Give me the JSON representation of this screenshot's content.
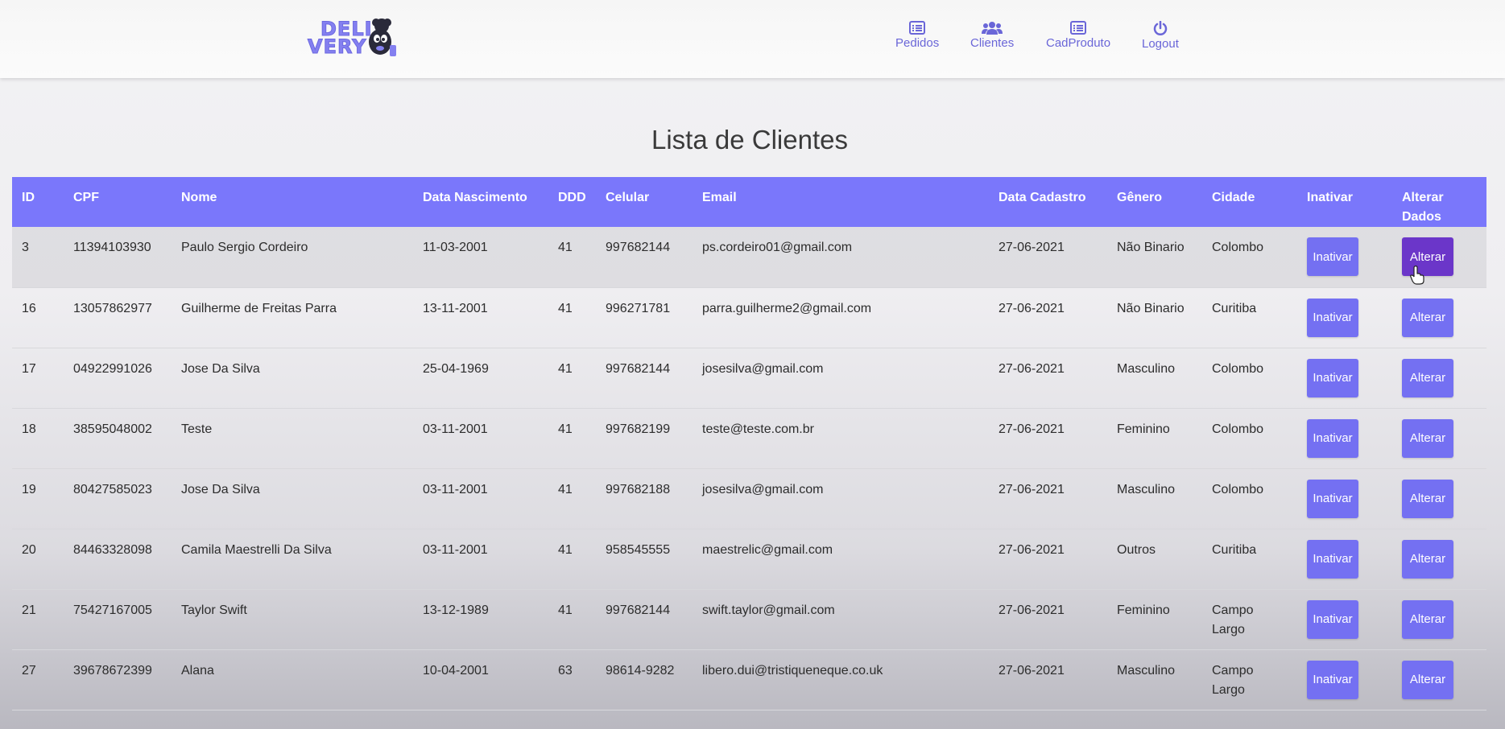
{
  "brand": {
    "logo_text_line1": "DELI",
    "logo_text_line2": "VERY"
  },
  "nav": {
    "items": [
      {
        "label": "Pedidos",
        "icon": "list-icon"
      },
      {
        "label": "Clientes",
        "icon": "users-icon"
      },
      {
        "label": "CadProduto",
        "icon": "list-icon"
      },
      {
        "label": "Logout",
        "icon": "power-icon"
      }
    ]
  },
  "page": {
    "title": "Lista de Clientes"
  },
  "table": {
    "headers": [
      "ID",
      "CPF",
      "Nome",
      "Data Nascimento",
      "DDD",
      "Celular",
      "Email",
      "Data Cadastro",
      "Gênero",
      "Cidade",
      "Inativar",
      "Alterar Dados"
    ],
    "inativar_label": "Inativar",
    "alterar_label": "Alterar",
    "rows": [
      [
        "3",
        "11394103930",
        "Paulo Sergio Cordeiro",
        "11-03-2001",
        "41",
        "997682144",
        "ps.cordeiro01@gmail.com",
        "27-06-2021",
        "Não Binario",
        "Colombo"
      ],
      [
        "16",
        "13057862977",
        "Guilherme de Freitas Parra",
        "13-11-2001",
        "41",
        "996271781",
        "parra.guilherme2@gmail.com",
        "27-06-2021",
        "Não Binario",
        "Curitiba"
      ],
      [
        "17",
        "04922991026",
        "Jose Da Silva",
        "25-04-1969",
        "41",
        "997682144",
        "josesilva@gmail.com",
        "27-06-2021",
        "Masculino",
        "Colombo"
      ],
      [
        "18",
        "38595048002",
        "Teste",
        "03-11-2001",
        "41",
        "997682199",
        "teste@teste.com.br",
        "27-06-2021",
        "Feminino",
        "Colombo"
      ],
      [
        "19",
        "80427585023",
        "Jose Da Silva",
        "03-11-2001",
        "41",
        "997682188",
        "josesilva@gmail.com",
        "27-06-2021",
        "Masculino",
        "Colombo"
      ],
      [
        "20",
        "84463328098",
        "Camila Maestrelli Da Silva",
        "03-11-2001",
        "41",
        "958545555",
        "maestrelic@gmail.com",
        "27-06-2021",
        "Outros",
        "Curitiba"
      ],
      [
        "21",
        "75427167005",
        "Taylor Swift",
        "13-12-1989",
        "41",
        "997682144",
        "swift.taylor@gmail.com",
        "27-06-2021",
        "Feminino",
        "Campo Largo"
      ],
      [
        "27",
        "39678672399",
        "Alana",
        "10-04-2001",
        "63",
        "98614-9282",
        "libero.dui@tristiqueneque.co.uk",
        "27-06-2021",
        "Masculino",
        "Campo Largo"
      ]
    ]
  },
  "colors": {
    "accent": "#7a77fb",
    "button": "#7470f2",
    "button_active": "#6b36c9",
    "nav_text": "#6a66d8"
  }
}
